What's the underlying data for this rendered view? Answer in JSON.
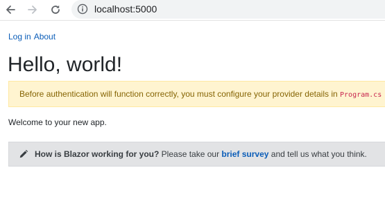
{
  "browser": {
    "url": "localhost:5000",
    "icons": {
      "back": "arrow-left-icon",
      "forward": "arrow-right-icon",
      "reload": "reload-icon",
      "site_info": "info-circle-icon"
    }
  },
  "nav": {
    "login_label": "Log in",
    "about_label": "About"
  },
  "main": {
    "title": "Hello, world!",
    "alert": {
      "text": "Before authentication will function correctly, you must configure your provider details in",
      "code": "Program.cs"
    },
    "welcome": "Welcome to your new app.",
    "survey": {
      "icon": "pencil-icon",
      "question": "How is Blazor working for you?",
      "text_before_link": " Please take our ",
      "link_label": "brief survey",
      "text_after_link": " and tell us what you think."
    }
  },
  "colors": {
    "link": "#0b5db8",
    "alert_bg": "#fff4d0",
    "alert_text": "#856404",
    "code_text": "#c7254e",
    "survey_bg": "#e2e3e5"
  }
}
